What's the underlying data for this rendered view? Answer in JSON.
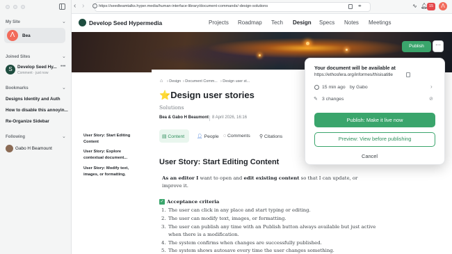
{
  "browser": {
    "url": "https://seedteamtalks.hyper.media/human-interface-library/document-commands/-design-solutions",
    "notification_count": "15"
  },
  "sidebar": {
    "my_site_label": "My Site",
    "my_site_name": "Bea",
    "joined_label": "Joined Sites",
    "joined": [
      {
        "name": "Develop Seed Hy...",
        "sub": "Comment · just now"
      }
    ],
    "bookmarks_label": "Bookmarks",
    "bookmarks": [
      "Designs Identity and Auth",
      "How to disable this annoyin...",
      "Re-Organize Sidebar"
    ],
    "following_label": "Following",
    "following": [
      "Gabo H Beamount"
    ]
  },
  "site_nav": {
    "site_title": "Develop Seed Hypermedia",
    "links": [
      "Projects",
      "Roadmap",
      "Tech",
      "Design",
      "Specs",
      "Notes",
      "Meetings"
    ],
    "active": "Design"
  },
  "doc": {
    "breadcrumb": [
      "Design",
      "Document Comm...",
      "Design user st..."
    ],
    "title_emoji": "⭐",
    "title": "Design user stories",
    "subtitle": "Solutions",
    "author": "Bea & Gabo H Beaumont",
    "date": "8 April 2026, 16:16",
    "tabs": [
      "Content",
      "People",
      "Comments",
      "Citations"
    ],
    "heading": "User Story: Start Editing Content",
    "intro_pre": "As an editor I",
    "intro_mid": " want to open and ",
    "intro_bold": "edit existing content",
    "intro_post": " so that I can update, or",
    "intro_line2": "improve it.",
    "acceptance_label": "Acceptance criteria",
    "criteria": [
      "The user can click in any place and start typing or editing.",
      "The user can modify text, images, or formatting.",
      "The user can publish any time with an Publish button always available but just active",
      "when there is a modification.",
      "The system confirms when changes are successfully published.",
      "The system shows autosave every time the user changes something."
    ],
    "criteria_numbers": [
      "1.",
      "2.",
      "3.",
      "",
      "4.",
      "5."
    ]
  },
  "outline": [
    "User Story: Start Editing Content",
    "User Story: Explore contextual document...",
    "User Story: Modify text, images, or formatting."
  ],
  "publish": {
    "button_label": "Publish",
    "headline": "Your document will be available at",
    "link": "https://ethosfera.org/informes/thisisatitle",
    "time_info": "15 min ago",
    "by_info": "by Gabo",
    "changes": "3 changes",
    "primary": "Publish: Make it live now",
    "preview": "Preview: View before publishing",
    "cancel": "Cancel"
  },
  "colors": {
    "accent": "#3aa56c",
    "badge": "#e5484d"
  }
}
